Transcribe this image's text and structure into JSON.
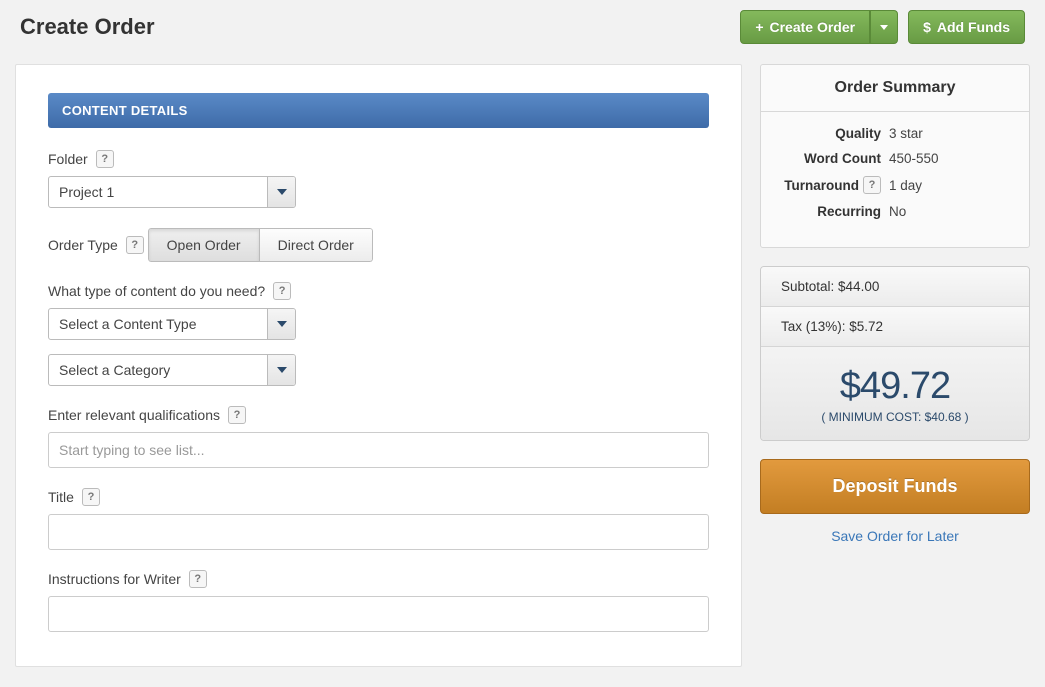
{
  "header": {
    "title": "Create Order",
    "create_order_label": "Create Order",
    "add_funds_label": "Add Funds"
  },
  "section_header": "CONTENT DETAILS",
  "fields": {
    "folder": {
      "label": "Folder",
      "value": "Project 1"
    },
    "order_type": {
      "label": "Order Type",
      "open": "Open Order",
      "direct": "Direct Order"
    },
    "content_type": {
      "label": "What type of content do you need?",
      "value": "Select a Content Type"
    },
    "category": {
      "value": "Select a Category"
    },
    "qualifications": {
      "label": "Enter relevant qualifications",
      "placeholder": "Start typing to see list..."
    },
    "title_field": {
      "label": "Title"
    },
    "instructions": {
      "label": "Instructions for Writer"
    }
  },
  "summary": {
    "title": "Order Summary",
    "quality": {
      "label": "Quality",
      "value": "3 star"
    },
    "word_count": {
      "label": "Word Count",
      "value": "450-550"
    },
    "turnaround": {
      "label": "Turnaround",
      "value": "1 day"
    },
    "recurring": {
      "label": "Recurring",
      "value": "No"
    }
  },
  "cost": {
    "subtotal": "Subtotal: $44.00",
    "tax": "Tax (13%): $5.72",
    "total": "$49.72",
    "min": "( MINIMUM COST: $40.68 )"
  },
  "actions": {
    "deposit": "Deposit Funds",
    "save": "Save Order for Later"
  }
}
